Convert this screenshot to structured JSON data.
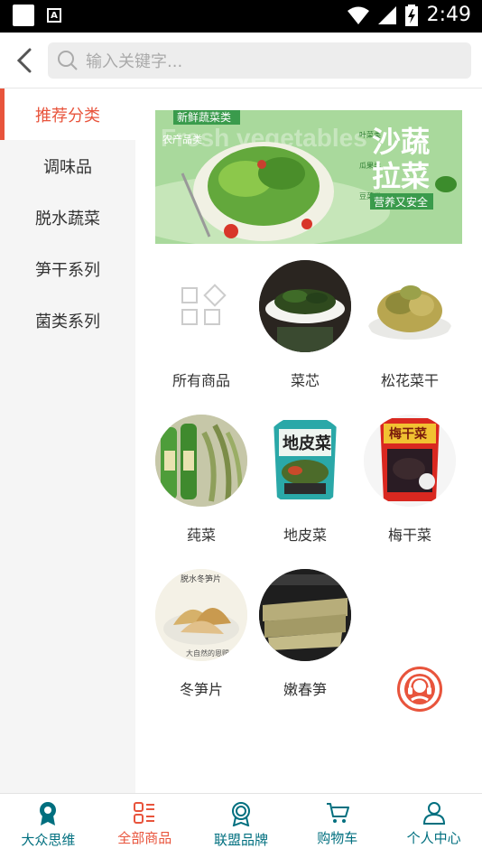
{
  "status_bar": {
    "time": "2:49"
  },
  "search": {
    "placeholder": "输入关键字..."
  },
  "sidebar": {
    "items": [
      {
        "label": "推荐分类",
        "active": true
      },
      {
        "label": "调味品"
      },
      {
        "label": "脱水蔬菜"
      },
      {
        "label": "笋干系列"
      },
      {
        "label": "菌类系列"
      }
    ]
  },
  "banner": {
    "tag": "新鲜蔬菜类",
    "sub_left": "农产品类",
    "bg_text": "Fresh vegetables",
    "side_text": [
      "叶菜类",
      "瓜果类",
      "豆菜类"
    ],
    "title_line1": "沙蔬",
    "title_line2": "拉菜",
    "slogan": "营养又安全"
  },
  "products": [
    {
      "label": "所有商品"
    },
    {
      "label": "菜芯"
    },
    {
      "label": "松花菜干"
    },
    {
      "label": "莼菜"
    },
    {
      "label": "地皮菜"
    },
    {
      "label": "梅干菜"
    },
    {
      "label": "冬笋片"
    },
    {
      "label": "嫩春笋"
    }
  ],
  "package_text": {
    "dipi": "地皮菜",
    "meigan": "梅干菜",
    "dongsun_top": "脱水冬笋片",
    "dongsun_bottom": "大自然的恩赐"
  },
  "tabbar": {
    "items": [
      {
        "label": "大众思维",
        "color": "#006f7f"
      },
      {
        "label": "全部商品",
        "color": "#e8543c"
      },
      {
        "label": "联盟品牌",
        "color": "#006f7f"
      },
      {
        "label": "购物车",
        "color": "#006f7f"
      },
      {
        "label": "个人中心",
        "color": "#006f7f"
      }
    ]
  },
  "colors": {
    "accent": "#e8543c",
    "tab": "#006f7f"
  }
}
